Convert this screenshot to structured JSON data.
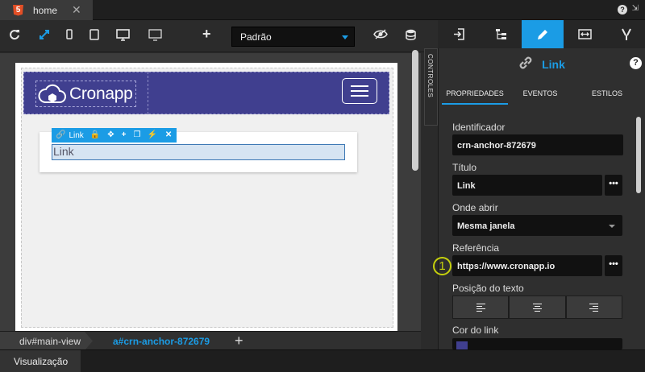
{
  "file_tab": {
    "label": "home",
    "close": "✕",
    "icon": "html5-icon",
    "badge": "5"
  },
  "window": {
    "help": "?",
    "collapse": "⇲"
  },
  "toolbar": {
    "device": "Padrão",
    "icons": [
      "refresh-icon",
      "expand-icon",
      "phone-icon",
      "tablet-icon",
      "desktop-icon",
      "monitor-icon",
      "plus-icon",
      "eye-off-icon",
      "database-icon"
    ]
  },
  "canvas": {
    "logo": "Cronapp",
    "link_text": "Link",
    "selection_toolbar": {
      "label": "Link"
    }
  },
  "controles": "CONTROLES",
  "breadcrumb": {
    "items": [
      "div#main-view",
      "a#crn-anchor-872679"
    ],
    "add": "+"
  },
  "bottom": {
    "tab": "Visualização"
  },
  "panel": {
    "component_name": "Link",
    "help": "?",
    "tabs": [
      "PROPRIEDADES",
      "EVENTOS",
      "ESTILOS"
    ],
    "fields": {
      "identificador_label": "Identificador",
      "identificador_value": "crn-anchor-872679",
      "titulo_label": "Título",
      "titulo_value": "Link",
      "onde_abrir_label": "Onde abrir",
      "onde_abrir_value": "Mesma janela",
      "referencia_label": "Referência",
      "referencia_value": "https://www.cronapp.io",
      "posicao_label": "Posição do texto",
      "cor_label": "Cor do link",
      "ellipsis": "•••"
    },
    "marker": "1"
  },
  "colors": {
    "accent": "#1b9ce5",
    "navbar": "#403f8f",
    "marker": "#c6d10c"
  }
}
